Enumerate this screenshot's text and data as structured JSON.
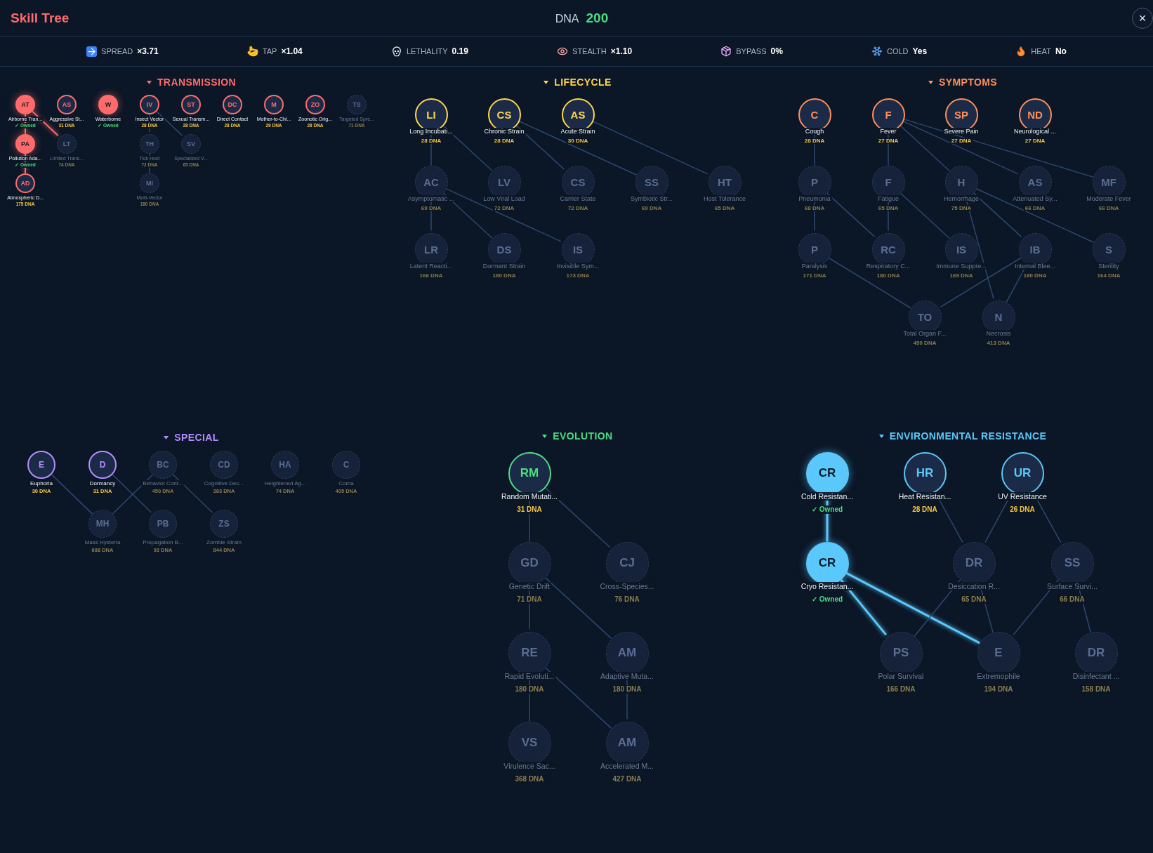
{
  "header": {
    "title": "Skill Tree",
    "dna_label": "DNA",
    "dna_value": "200",
    "close": "×"
  },
  "stats": [
    {
      "label": "SPREAD",
      "value": "×3.71"
    },
    {
      "label": "TAP",
      "value": "×1.04"
    },
    {
      "label": "LETHALITY",
      "value": "0.19"
    },
    {
      "label": "STEALTH",
      "value": "×1.10"
    },
    {
      "label": "BYPASS",
      "value": "0%"
    },
    {
      "label": "COLD",
      "value": "Yes"
    },
    {
      "label": "HEAT",
      "value": "No"
    }
  ],
  "panels": [
    {
      "title": "TRANSMISSION",
      "color": "#ff6b6b",
      "nodes": [
        {
          "abbr": "AT",
          "name": "Airborne Tran...",
          "caption": "✓ Owned",
          "owned": true,
          "locked": false
        },
        {
          "abbr": "AS",
          "name": "Aggressive St...",
          "caption": "31 DNA",
          "owned": false,
          "locked": false
        },
        {
          "abbr": "W",
          "name": "Waterborne",
          "caption": "✓ Owned",
          "owned": true,
          "locked": false
        },
        {
          "abbr": "IV",
          "name": "Insect Vector",
          "caption": "28 DNA",
          "owned": false,
          "locked": false
        },
        {
          "abbr": "ST",
          "name": "Sexual Transm...",
          "caption": "28 DNA",
          "owned": false,
          "locked": false
        },
        {
          "abbr": "DC",
          "name": "Direct Contact",
          "caption": "28 DNA",
          "owned": false,
          "locked": false
        },
        {
          "abbr": "M",
          "name": "Mother-to-Chi...",
          "caption": "29 DNA",
          "owned": false,
          "locked": false
        },
        {
          "abbr": "ZO",
          "name": "Zoonotic Orig...",
          "caption": "28 DNA",
          "owned": false,
          "locked": false
        },
        {
          "abbr": "TS",
          "name": "Targeted Spre...",
          "caption": "71 DNA",
          "owned": false,
          "locked": true
        },
        {
          "abbr": "PA",
          "name": "Pollution Ada...",
          "caption": "✓ Owned",
          "owned": true,
          "locked": false
        },
        {
          "abbr": "LT",
          "name": "Limited Trans...",
          "caption": "74 DNA",
          "owned": false,
          "locked": true
        },
        {
          "abbr": "TH",
          "name": "Tick Host",
          "caption": "72 DNA",
          "owned": false,
          "locked": true
        },
        {
          "abbr": "SV",
          "name": "Specialized V...",
          "caption": "65 DNA",
          "owned": false,
          "locked": true
        },
        {
          "abbr": "AD",
          "name": "Atmospheric D...",
          "caption": "175 DNA",
          "owned": false,
          "locked": false
        },
        {
          "abbr": "MI",
          "name": "Multi-Vector",
          "caption": "180 DNA",
          "owned": false,
          "locked": true
        }
      ]
    },
    {
      "title": "LIFECYCLE",
      "color": "#ffd54a",
      "nodes": [
        {
          "abbr": "LI",
          "name": "Long Incubati...",
          "caption": "28 DNA",
          "owned": false,
          "locked": false
        },
        {
          "abbr": "CS",
          "name": "Chronic Strain",
          "caption": "28 DNA",
          "owned": false,
          "locked": false
        },
        {
          "abbr": "AS",
          "name": "Acute Strain",
          "caption": "30 DNA",
          "owned": false,
          "locked": false
        },
        {
          "abbr": "AC",
          "name": "Asymptomatic ...",
          "caption": "69 DNA",
          "owned": false,
          "locked": true
        },
        {
          "abbr": "LV",
          "name": "Low Viral Load",
          "caption": "72 DNA",
          "owned": false,
          "locked": true
        },
        {
          "abbr": "CS",
          "name": "Carrier State",
          "caption": "72 DNA",
          "owned": false,
          "locked": true
        },
        {
          "abbr": "SS",
          "name": "Symbiotic Str...",
          "caption": "69 DNA",
          "owned": false,
          "locked": true
        },
        {
          "abbr": "HT",
          "name": "Host Tolerance",
          "caption": "65 DNA",
          "owned": false,
          "locked": true
        },
        {
          "abbr": "LR",
          "name": "Latent Reacti...",
          "caption": "166 DNA",
          "owned": false,
          "locked": true
        },
        {
          "abbr": "DS",
          "name": "Dormant Strain",
          "caption": "180 DNA",
          "owned": false,
          "locked": true
        },
        {
          "abbr": "IS",
          "name": "Invisible Sym...",
          "caption": "173 DNA",
          "owned": false,
          "locked": true
        }
      ]
    },
    {
      "title": "SYMPTOMS",
      "color": "#ff8f57",
      "nodes": [
        {
          "abbr": "C",
          "name": "Cough",
          "caption": "28 DNA",
          "owned": false,
          "locked": false
        },
        {
          "abbr": "F",
          "name": "Fever",
          "caption": "27 DNA",
          "owned": false,
          "locked": false
        },
        {
          "abbr": "SP",
          "name": "Severe Pain",
          "caption": "27 DNA",
          "owned": false,
          "locked": false
        },
        {
          "abbr": "ND",
          "name": "Neurological ...",
          "caption": "27 DNA",
          "owned": false,
          "locked": false
        },
        {
          "abbr": "P",
          "name": "Pneumonia",
          "caption": "68 DNA",
          "owned": false,
          "locked": true
        },
        {
          "abbr": "F",
          "name": "Fatigue",
          "caption": "65 DNA",
          "owned": false,
          "locked": true
        },
        {
          "abbr": "H",
          "name": "Hemorrhage",
          "caption": "75 DNA",
          "owned": false,
          "locked": true
        },
        {
          "abbr": "AS",
          "name": "Attenuated Sy...",
          "caption": "66 DNA",
          "owned": false,
          "locked": true
        },
        {
          "abbr": "MF",
          "name": "Moderate Fever",
          "caption": "66 DNA",
          "owned": false,
          "locked": true
        },
        {
          "abbr": "P",
          "name": "Paralysis",
          "caption": "171 DNA",
          "owned": false,
          "locked": true
        },
        {
          "abbr": "RC",
          "name": "Respiratory C...",
          "caption": "180 DNA",
          "owned": false,
          "locked": true
        },
        {
          "abbr": "IS",
          "name": "Immune Suppre...",
          "caption": "169 DNA",
          "owned": false,
          "locked": true
        },
        {
          "abbr": "IB",
          "name": "Internal Blee...",
          "caption": "180 DNA",
          "owned": false,
          "locked": true
        },
        {
          "abbr": "S",
          "name": "Sterility",
          "caption": "164 DNA",
          "owned": false,
          "locked": true
        },
        {
          "abbr": "TO",
          "name": "Total Organ F...",
          "caption": "450 DNA",
          "owned": false,
          "locked": true
        },
        {
          "abbr": "N",
          "name": "Necrosis",
          "caption": "413 DNA",
          "owned": false,
          "locked": true
        }
      ]
    },
    {
      "title": "SPECIAL",
      "color": "#b48cff",
      "nodes": [
        {
          "abbr": "E",
          "name": "Euphoria",
          "caption": "30 DNA",
          "owned": false,
          "locked": false
        },
        {
          "abbr": "D",
          "name": "Dormancy",
          "caption": "31 DNA",
          "owned": false,
          "locked": false
        },
        {
          "abbr": "BC",
          "name": "Behavior Cont...",
          "caption": "450 DNA",
          "owned": false,
          "locked": true
        },
        {
          "abbr": "CD",
          "name": "Cognitive Dec...",
          "caption": "383 DNA",
          "owned": false,
          "locked": true
        },
        {
          "abbr": "HA",
          "name": "Heightened Ag...",
          "caption": "74 DNA",
          "owned": false,
          "locked": true
        },
        {
          "abbr": "C",
          "name": "Coma",
          "caption": "405 DNA",
          "owned": false,
          "locked": true
        },
        {
          "abbr": "MH",
          "name": "Mass Hysteria",
          "caption": "688 DNA",
          "owned": false,
          "locked": true
        },
        {
          "abbr": "PB",
          "name": "Propagation B...",
          "caption": "93 DNA",
          "owned": false,
          "locked": true
        },
        {
          "abbr": "ZS",
          "name": "Zombie Strain",
          "caption": "844 DNA",
          "owned": false,
          "locked": true
        }
      ]
    },
    {
      "title": "EVOLUTION",
      "color": "#4ade80",
      "nodes": [
        {
          "abbr": "RM",
          "name": "Random Mutati...",
          "caption": "31 DNA",
          "owned": false,
          "locked": false
        },
        {
          "abbr": "GD",
          "name": "Genetic Drift",
          "caption": "71 DNA",
          "owned": false,
          "locked": true
        },
        {
          "abbr": "CJ",
          "name": "Cross-Species...",
          "caption": "76 DNA",
          "owned": false,
          "locked": true
        },
        {
          "abbr": "RE",
          "name": "Rapid Evoluti...",
          "caption": "180 DNA",
          "owned": false,
          "locked": true
        },
        {
          "abbr": "AM",
          "name": "Adaptive Muta...",
          "caption": "180 DNA",
          "owned": false,
          "locked": true
        },
        {
          "abbr": "VS",
          "name": "Virulence Sac...",
          "caption": "368 DNA",
          "owned": false,
          "locked": true
        },
        {
          "abbr": "AM",
          "name": "Accelerated M...",
          "caption": "427 DNA",
          "owned": false,
          "locked": true
        }
      ]
    },
    {
      "title": "ENVIRONMENTAL RESISTANCE",
      "color": "#5ac8fa",
      "nodes": [
        {
          "abbr": "CR",
          "name": "Cold Resistan...",
          "caption": "✓ Owned",
          "owned": true,
          "locked": false
        },
        {
          "abbr": "HR",
          "name": "Heat Resistan...",
          "caption": "28 DNA",
          "owned": false,
          "locked": false
        },
        {
          "abbr": "UR",
          "name": "UV Resistance",
          "caption": "26 DNA",
          "owned": false,
          "locked": false
        },
        {
          "abbr": "CR",
          "name": "Cryo Resistan...",
          "caption": "✓ Owned",
          "owned": true,
          "locked": false
        },
        {
          "abbr": "DR",
          "name": "Desiccation R...",
          "caption": "65 DNA",
          "owned": false,
          "locked": true
        },
        {
          "abbr": "SS",
          "name": "Surface Survi...",
          "caption": "66 DNA",
          "owned": false,
          "locked": true
        },
        {
          "abbr": "PS",
          "name": "Polar Survival",
          "caption": "166 DNA",
          "owned": false,
          "locked": true
        },
        {
          "abbr": "E",
          "name": "Extremophile",
          "caption": "194 DNA",
          "owned": false,
          "locked": true
        },
        {
          "abbr": "DR",
          "name": "Disinfectant ...",
          "caption": "158 DNA",
          "owned": false,
          "locked": true
        }
      ]
    }
  ]
}
